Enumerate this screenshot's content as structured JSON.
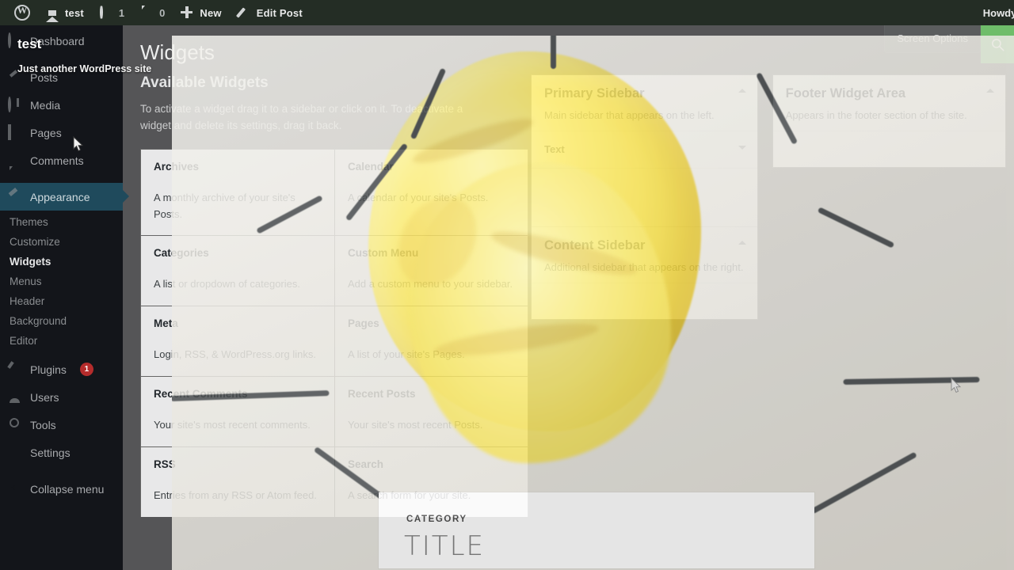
{
  "adminbar": {
    "wp_logo": "wordpress-logo",
    "site_name": "test",
    "updates_count": "1",
    "comments_count": "0",
    "new_label": "New",
    "edit_post_label": "Edit Post",
    "howdy": "Howdy,"
  },
  "sidebar": {
    "site_title_overlay": "test",
    "site_tagline_overlay": "Just another WordPress site",
    "items": [
      {
        "label": "Dashboard",
        "icon": "dashboard-icon"
      },
      {
        "label": "Posts",
        "icon": "pin-icon"
      },
      {
        "label": "Media",
        "icon": "media-icon"
      },
      {
        "label": "Pages",
        "icon": "pages-icon"
      },
      {
        "label": "Comments",
        "icon": "comment-icon"
      },
      {
        "label": "Appearance",
        "icon": "appearance-icon"
      },
      {
        "label": "Plugins",
        "icon": "plug-icon",
        "badge": "1"
      },
      {
        "label": "Users",
        "icon": "user-icon"
      },
      {
        "label": "Tools",
        "icon": "wrench-icon"
      },
      {
        "label": "Settings",
        "icon": "settings-icon"
      },
      {
        "label": "Collapse menu",
        "icon": "collapse-icon"
      }
    ],
    "appearance_submenu": [
      {
        "label": "Themes"
      },
      {
        "label": "Customize"
      },
      {
        "label": "Widgets"
      },
      {
        "label": "Menus"
      },
      {
        "label": "Header"
      },
      {
        "label": "Background"
      },
      {
        "label": "Editor"
      }
    ],
    "active_item": "Appearance",
    "active_subitem": "Widgets"
  },
  "screen_meta": {
    "screen_options_label": "Screen Options",
    "search_icon": "search-icon",
    "search_button_color": "#6fbd6a"
  },
  "page": {
    "title": "Widgets",
    "available_heading": "Available Widgets",
    "available_description": "To activate a widget drag it to a sidebar or click on it. To deactivate a widget and delete its settings, drag it back."
  },
  "available_widgets": [
    {
      "name": "Archives",
      "description": "A monthly archive of your site's Posts."
    },
    {
      "name": "Calendar",
      "description": "A calendar of your site's Posts."
    },
    {
      "name": "Categories",
      "description": "A list or dropdown of categories."
    },
    {
      "name": "Custom Menu",
      "description": "Add a custom menu to your sidebar."
    },
    {
      "name": "Meta",
      "description": "Login, RSS, & WordPress.org links."
    },
    {
      "name": "Pages",
      "description": "A list of your site's Pages."
    },
    {
      "name": "Recent Comments",
      "description": "Your site's most recent comments."
    },
    {
      "name": "Recent Posts",
      "description": "Your site's most recent Posts."
    },
    {
      "name": "RSS",
      "description": "Entries from any RSS or Atom feed."
    },
    {
      "name": "Search",
      "description": "A search form for your site."
    }
  ],
  "sidebars": [
    {
      "title": "Primary Sidebar",
      "description": "Main sidebar that appears on the left.",
      "widgets": [
        {
          "name": "Text"
        }
      ]
    },
    {
      "title": "Content Sidebar",
      "description": "Additional sidebar that appears on the right.",
      "widgets": []
    },
    {
      "title": "Footer Widget Area",
      "description": "Appears in the footer section of the site.",
      "widgets": []
    }
  ],
  "overlay_card": {
    "category": "CATEGORY",
    "title": "TITLE"
  }
}
